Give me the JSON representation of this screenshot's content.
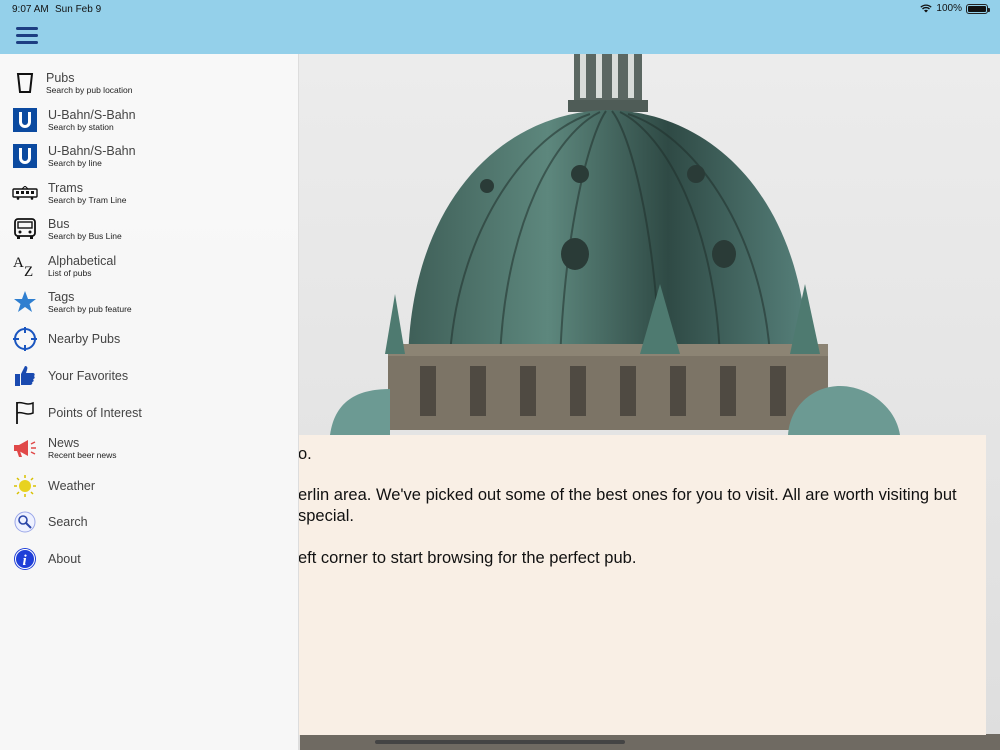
{
  "status_bar": {
    "time": "9:07 AM",
    "date": "Sun Feb 9",
    "battery": "100%"
  },
  "menu": {
    "items": [
      {
        "title": "Pubs",
        "subtitle": "Search by pub location",
        "icon": "pint-glass-icon"
      },
      {
        "title": "U-Bahn/S-Bahn",
        "subtitle": "Search by station",
        "icon": "ubahn-icon"
      },
      {
        "title": "U-Bahn/S-Bahn",
        "subtitle": "Search by line",
        "icon": "ubahn-icon"
      },
      {
        "title": "Trams",
        "subtitle": "Search by Tram Line",
        "icon": "tram-icon"
      },
      {
        "title": "Bus",
        "subtitle": "Search by Bus Line",
        "icon": "bus-icon"
      },
      {
        "title": "Alphabetical",
        "subtitle": "List of pubs",
        "icon": "az-icon"
      },
      {
        "title": "Tags",
        "subtitle": "Search by pub feature",
        "icon": "star-icon"
      },
      {
        "title": "Nearby Pubs",
        "subtitle": "",
        "icon": "crosshair-icon"
      },
      {
        "title": "Your Favorites",
        "subtitle": "",
        "icon": "thumbs-up-icon"
      },
      {
        "title": "Points of Interest",
        "subtitle": "",
        "icon": "flag-icon"
      },
      {
        "title": "News",
        "subtitle": "Recent beer news",
        "icon": "megaphone-icon"
      },
      {
        "title": "Weather",
        "subtitle": "",
        "icon": "sun-icon"
      },
      {
        "title": "Search",
        "subtitle": "",
        "icon": "magnifier-icon"
      },
      {
        "title": "About",
        "subtitle": "",
        "icon": "info-icon"
      }
    ]
  },
  "card": {
    "line1": "o.",
    "line2": "erlin area. We've picked out some of the best ones for you to visit. All are worth visiting but",
    "line3": "special.",
    "line4": "eft corner to start browsing for the perfect pub."
  },
  "colors": {
    "nav_bar": "#94d0ea",
    "card_bg": "#f9efe5",
    "ubahn_blue": "#0b4aa0",
    "star_blue": "#2f7fd0"
  }
}
